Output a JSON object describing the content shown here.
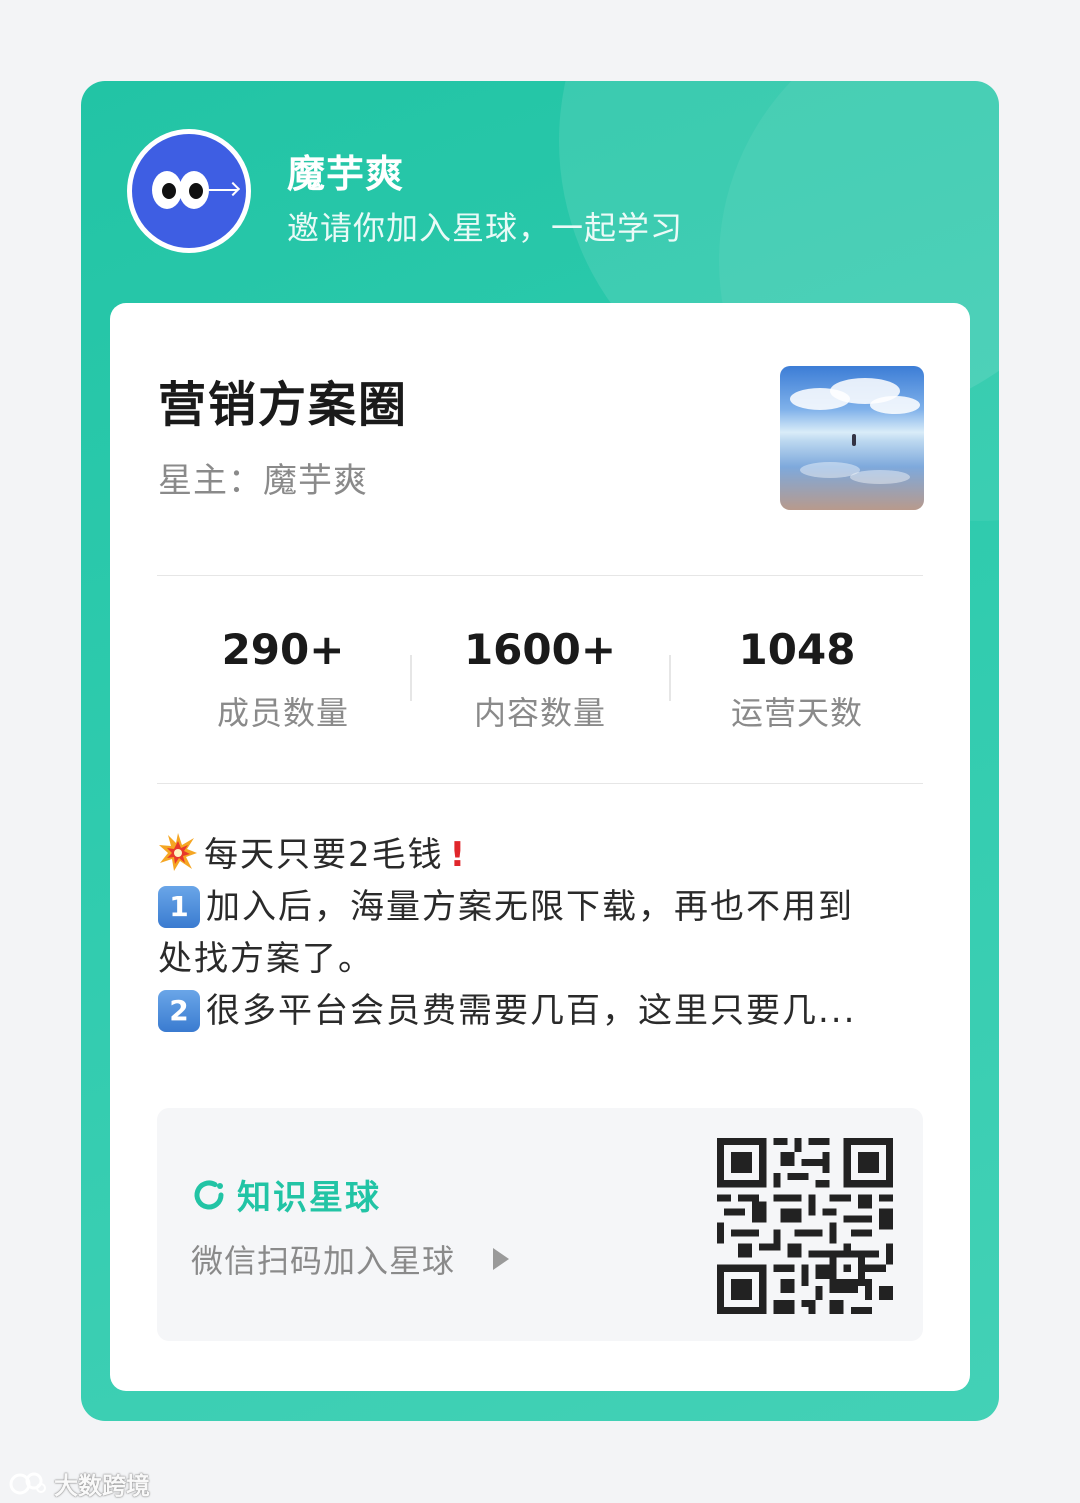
{
  "header": {
    "host_name": "魔芋爽",
    "invite_text": "邀请你加入星球，一起学习"
  },
  "planet": {
    "title": "营销方案圈",
    "owner_label": "星主：",
    "owner_name": "魔芋爽"
  },
  "stats": [
    {
      "value": "290+",
      "label": "成员数量"
    },
    {
      "value": "1600+",
      "label": "内容数量"
    },
    {
      "value": "1048",
      "label": "运营天数"
    }
  ],
  "description": {
    "line1": "每天只要2毛钱",
    "item1_key": "1",
    "item1_text": "加入后，海量方案无限下载，再也不用到",
    "item1_cont": "处找方案了。",
    "item2_key": "2",
    "item2_text": "很多平台会员费需要几百，这里只要几..."
  },
  "join": {
    "brand": "知识星球",
    "scan_text": "微信扫码加入星球"
  },
  "watermark": "大数跨境",
  "colors": {
    "brand_green": "#22c4a5",
    "avatar_blue": "#3e5ee3",
    "alert_red": "#e0262b"
  }
}
